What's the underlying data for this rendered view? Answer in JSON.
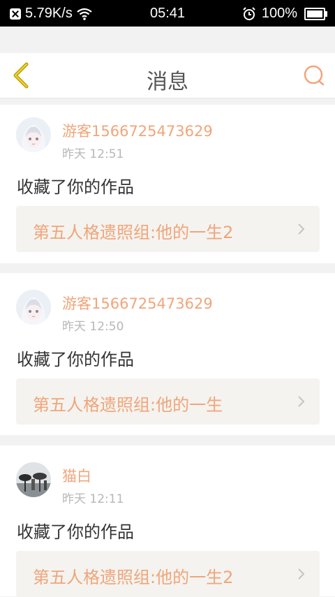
{
  "status_bar": {
    "network_speed": "5.79K/s",
    "time": "05:41",
    "battery": "100%"
  },
  "header": {
    "title": "消息"
  },
  "messages": [
    {
      "username": "游客1566725473629",
      "time": "昨天 12:51",
      "action": "收藏了你的作品",
      "work_title": "第五人格遗照组:他的一生2"
    },
    {
      "username": "游客1566725473629",
      "time": "昨天 12:50",
      "action": "收藏了你的作品",
      "work_title": "第五人格遗照组:他的一生"
    },
    {
      "username": "猫白",
      "time": "昨天 12:11",
      "action": "收藏了你的作品",
      "work_title": "第五人格遗照组:他的一生2"
    }
  ],
  "colors": {
    "accent": "#f0a57a",
    "back_arrow": "#b8a000"
  }
}
